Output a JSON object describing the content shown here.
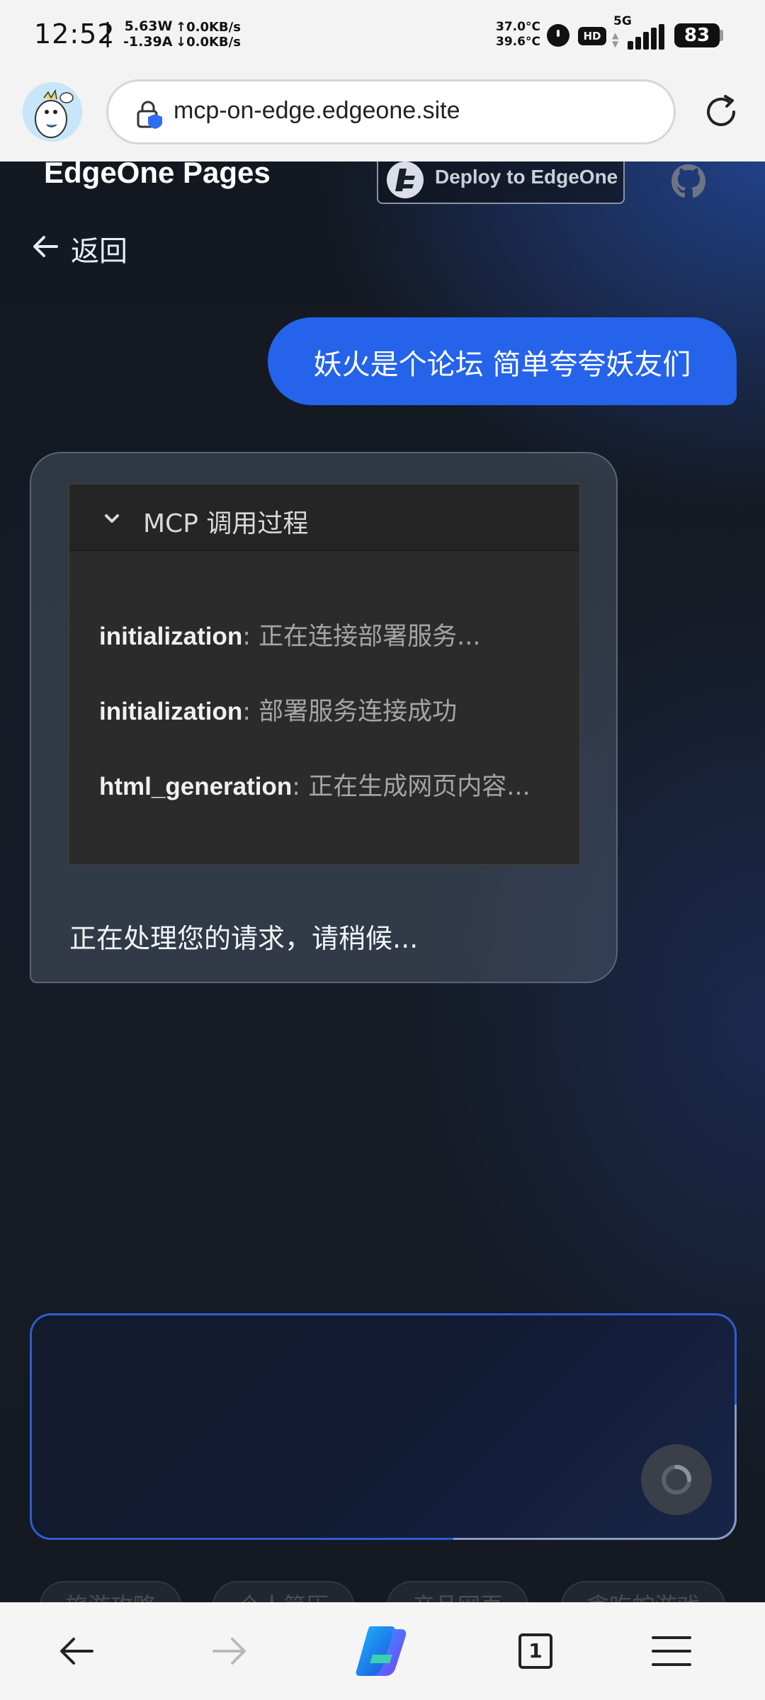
{
  "status_bar": {
    "time": "12:52",
    "separator": "|",
    "power_watts": "5.63W",
    "power_amps": "-1.39A",
    "upload_speed": "↑0.0KB/s",
    "download_speed": "↓0.0KB/s",
    "temp_1": "37.0°C",
    "temp_2": "39.6°C",
    "hd_badge": "HD",
    "network": "5G",
    "battery": "83"
  },
  "browser": {
    "url": "mcp-on-edge.edgeone.site"
  },
  "header": {
    "site_title": "EdgeOne Pages",
    "deploy_label": "Deploy to EdgeOne"
  },
  "back_link": {
    "label": "返回"
  },
  "chat": {
    "user_message": "妖火是个论坛 简单夸夸妖友们",
    "mcp_panel_title": "MCP 调用过程",
    "log": [
      {
        "key": "initialization",
        "message": "正在连接部署服务..."
      },
      {
        "key": "initialization",
        "message": "部署服务连接成功"
      },
      {
        "key": "html_generation",
        "message": "正在生成网页内容..."
      }
    ],
    "log_separator": ": ",
    "status": "正在处理您的请求，请稍候..."
  },
  "input": {
    "value": "",
    "placeholder": ""
  },
  "suggestions": [
    "旅游攻略",
    "个人简历",
    "产品网页",
    "贪吃蛇游戏"
  ],
  "bottom_nav": {
    "tab_count": "1"
  },
  "colors": {
    "user_bubble": "#2563eb",
    "input_border": "#2f5dcf",
    "browser_chrome": "#f3f3f3"
  }
}
